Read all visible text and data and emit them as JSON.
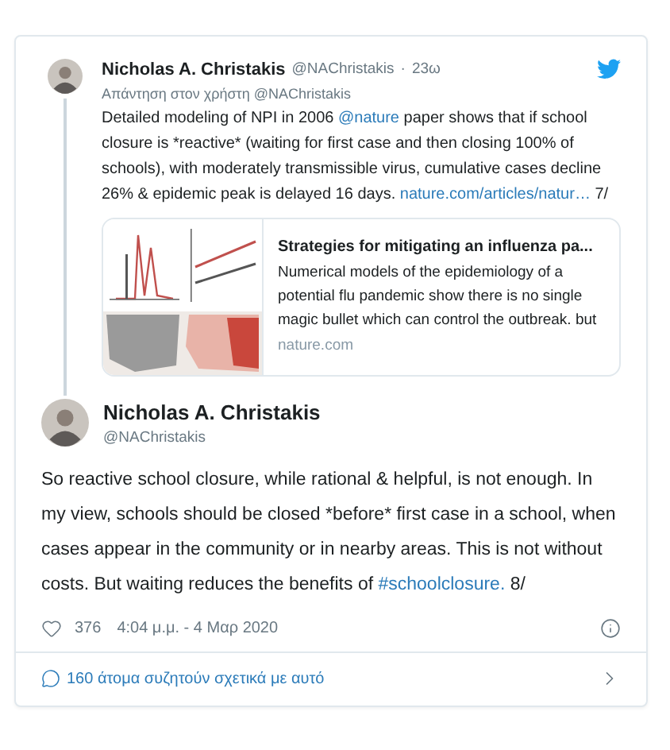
{
  "parent_tweet": {
    "name": "Nicholas A. Christakis",
    "handle": "@NAChristakis",
    "separator": "·",
    "time": "23ω",
    "reply_to": "Απάντηση στον χρήστη @NAChristakis",
    "body": [
      {
        "kind": "text",
        "text": "Detailed modeling of NPI in 2006 "
      },
      {
        "kind": "link",
        "text": "@nature"
      },
      {
        "kind": "text",
        "text": " paper shows that if school closure is *reactive* (waiting for first case and then closing 100% of schools), with moderately transmissible virus, cumulative cases decline 26% & epidemic peak is delayed 16 days. "
      },
      {
        "kind": "link",
        "text": "nature.com/articles/natur…"
      },
      {
        "kind": "text",
        "text": "  7/"
      }
    ],
    "link_card": {
      "title": "Strategies for mitigating an influenza pa...",
      "description": "Numerical models of the epidemiology of a potential flu pandemic show there is no single magic bullet which can control the outbreak. but",
      "domain": "nature.com"
    }
  },
  "main_tweet": {
    "name": "Nicholas A. Christakis",
    "handle": "@NAChristakis",
    "body": [
      {
        "kind": "text",
        "text": "So reactive school closure, while rational & helpful, is not enough. In my view, schools should be closed *before* first case in a school, when cases appear in the community or in nearby areas. This is not without costs. But waiting reduces the benefits of "
      },
      {
        "kind": "link",
        "text": "#schoolclosure."
      },
      {
        "kind": "text",
        "text": " 8/"
      }
    ],
    "likes": "376",
    "timestamp": "4:04 μ.μ. - 4 Μαρ 2020"
  },
  "conversation": {
    "label": "160 άτομα συζητούν σχετικά με αυτό"
  }
}
